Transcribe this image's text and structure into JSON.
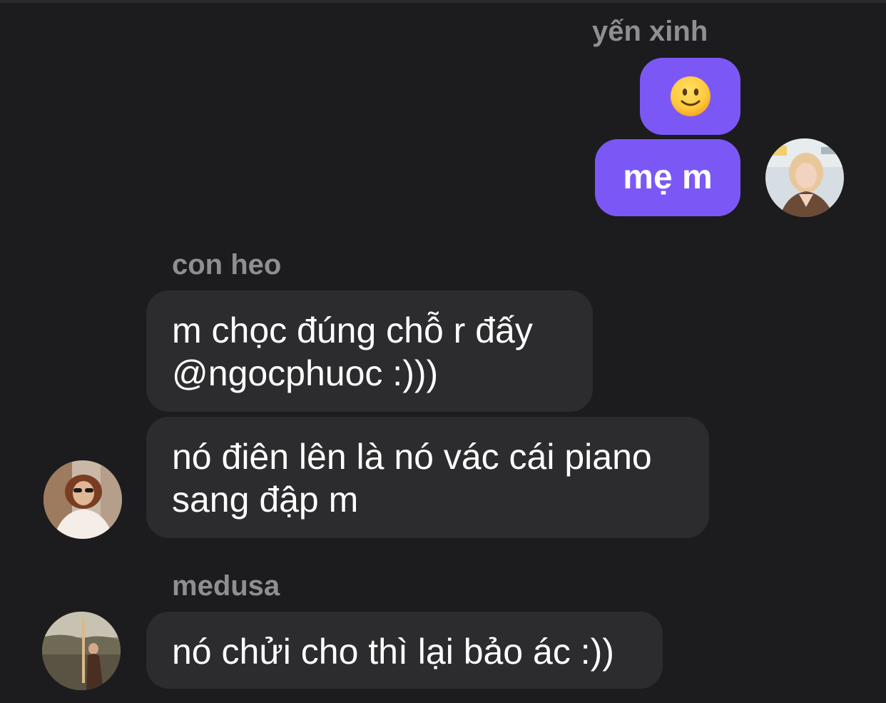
{
  "messages": {
    "outgoing": {
      "sender": "yến xinh",
      "emoji_icon": "slightly-smiling-face-icon",
      "text": "mẹ m"
    },
    "con_heo": {
      "sender": "con heo",
      "line1a": "m chọc đúng chỗ r đấy",
      "line1b": "@ngocphuoc :)))",
      "line2a": "nó điên lên là nó vác cái piano",
      "line2b": "sang đập m"
    },
    "medusa": {
      "sender": "medusa",
      "text": "nó chửi cho thì lại bảo ác :))"
    }
  },
  "colors": {
    "background": "#1c1c1e",
    "outgoing_bubble": "#7b58f6",
    "incoming_bubble": "#2c2c2e",
    "sender_name": "#8e8e93"
  }
}
